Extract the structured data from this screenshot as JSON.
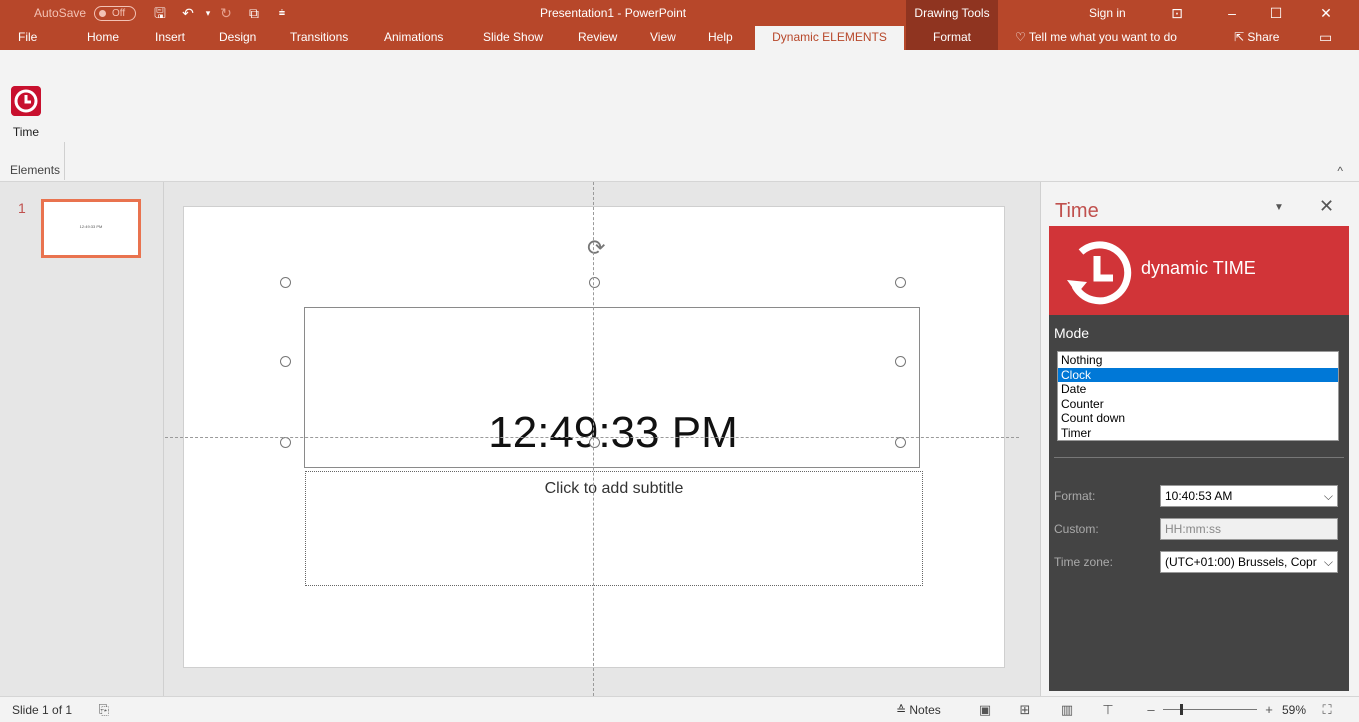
{
  "titlebar": {
    "autosave_label": "AutoSave",
    "autosave_state": "Off",
    "doc_title": "Presentation1 - PowerPoint",
    "contextual_group": "Drawing Tools",
    "sign_in": "Sign in"
  },
  "tabs": [
    {
      "label": "File"
    },
    {
      "label": "Home"
    },
    {
      "label": "Insert"
    },
    {
      "label": "Design"
    },
    {
      "label": "Transitions"
    },
    {
      "label": "Animations"
    },
    {
      "label": "Slide Show"
    },
    {
      "label": "Review"
    },
    {
      "label": "View"
    },
    {
      "label": "Help"
    },
    {
      "label": "Dynamic ELEMENTS"
    },
    {
      "label": "Format"
    }
  ],
  "tell_me": "Tell me what you want to do",
  "share_label": "Share",
  "ribbon": {
    "time_button": "Time",
    "group_label": "Elements"
  },
  "thumbnails": [
    {
      "number": "1",
      "text": "12:49:33 PM"
    }
  ],
  "slide": {
    "title_text": "12:49:33 PM",
    "subtitle_placeholder": "Click to add subtitle"
  },
  "pane": {
    "title": "Time",
    "banner_text": "dynamic TIME",
    "mode_label": "Mode",
    "modes": [
      "Nothing",
      "Clock",
      "Date",
      "Counter",
      "Count down",
      "Timer"
    ],
    "selected_mode": "Clock",
    "format_label": "Format:",
    "format_value": "10:40:53 AM",
    "custom_label": "Custom:",
    "custom_placeholder": "HH:mm:ss",
    "timezone_label": "Time zone:",
    "timezone_value": "(UTC+01:00) Brussels, Copr"
  },
  "statusbar": {
    "slide_info": "Slide 1 of 1",
    "notes_label": "Notes",
    "zoom": "59%"
  },
  "colors": {
    "brand": "#b7472a",
    "contextual": "#8f3420",
    "banner": "#d13438",
    "pane_dark": "#444444",
    "selection": "#0078d7"
  }
}
